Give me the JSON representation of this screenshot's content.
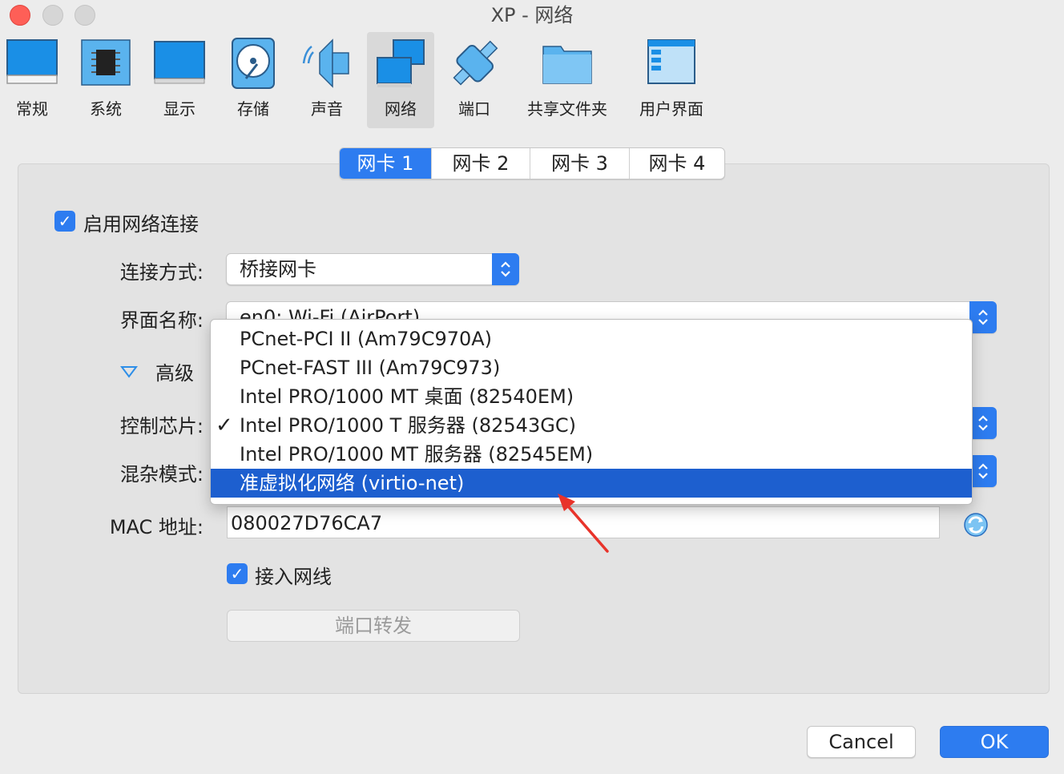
{
  "window": {
    "title": "XP - 网络"
  },
  "toolbar": {
    "items": [
      {
        "label": "常规",
        "icon": "monitor-general-icon"
      },
      {
        "label": "系统",
        "icon": "chip-icon"
      },
      {
        "label": "显示",
        "icon": "display-icon"
      },
      {
        "label": "存储",
        "icon": "disk-icon"
      },
      {
        "label": "声音",
        "icon": "speaker-icon"
      },
      {
        "label": "网络",
        "icon": "network-icon",
        "selected": true
      },
      {
        "label": "端口",
        "icon": "serial-port-icon"
      },
      {
        "label": "共享文件夹",
        "icon": "folder-icon"
      },
      {
        "label": "用户界面",
        "icon": "window-ui-icon"
      }
    ]
  },
  "tabs": [
    "网卡 1",
    "网卡 2",
    "网卡 3",
    "网卡 4"
  ],
  "active_tab": "网卡 1",
  "form": {
    "enable_label": "启用网络连接",
    "enable_checked": true,
    "attach_label": "连接方式:",
    "attach_value": "桥接网卡",
    "name_label": "界面名称:",
    "name_value": "en0: Wi-Fi (AirPort)",
    "advanced_label": "高级",
    "adapter_label": "控制芯片:",
    "promisc_label": "混杂模式:",
    "mac_label": "MAC 地址:",
    "mac_value": "080027D76CA7",
    "cable_label": "接入网线",
    "cable_checked": true,
    "port_forward_label": "端口转发"
  },
  "adapter_menu": {
    "options": [
      "PCnet-PCI II (Am79C970A)",
      "PCnet-FAST III (Am79C973)",
      "Intel PRO/1000 MT 桌面 (82540EM)",
      "Intel PRO/1000 T 服务器 (82543GC)",
      "Intel PRO/1000 MT 服务器 (82545EM)",
      "准虚拟化网络 (virtio-net)"
    ],
    "checked": "Intel PRO/1000 T 服务器 (82543GC)",
    "highlighted": "准虚拟化网络 (virtio-net)"
  },
  "buttons": {
    "cancel": "Cancel",
    "ok": "OK"
  },
  "colors": {
    "accent": "#2d7cf0",
    "highlight": "#1d5fcf",
    "annotation_arrow": "#e8332a"
  }
}
